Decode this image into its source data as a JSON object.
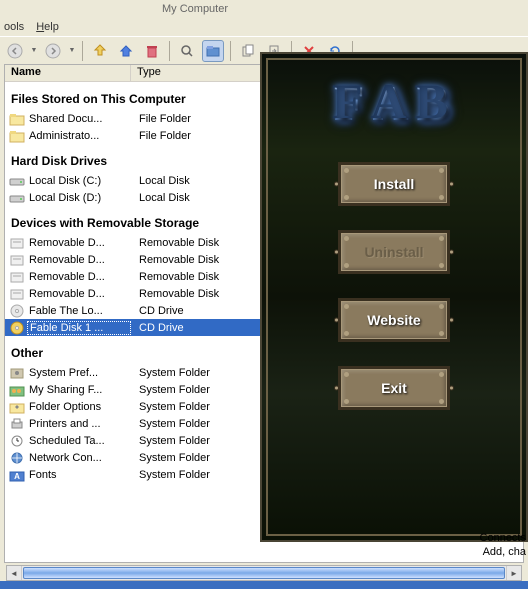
{
  "window": {
    "title": "My Computer"
  },
  "menu": {
    "tools": "ools",
    "help": "Help"
  },
  "columns": {
    "name": "Name",
    "type": "Type"
  },
  "groups": {
    "files_stored": "Files Stored on This Computer",
    "hard_drives": "Hard Disk Drives",
    "removable": "Devices with Removable Storage",
    "other": "Other"
  },
  "items": {
    "shared_docs": {
      "name": "Shared Docu...",
      "type": "File Folder"
    },
    "admin": {
      "name": "Administrato...",
      "type": "File Folder"
    },
    "disk_c": {
      "name": "Local Disk (C:)",
      "type": "Local Disk"
    },
    "disk_d": {
      "name": "Local Disk (D:)",
      "type": "Local Disk"
    },
    "rem1": {
      "name": "Removable D...",
      "type": "Removable Disk"
    },
    "rem2": {
      "name": "Removable D...",
      "type": "Removable Disk"
    },
    "rem3": {
      "name": "Removable D...",
      "type": "Removable Disk"
    },
    "rem4": {
      "name": "Removable D...",
      "type": "Removable Disk"
    },
    "fable_lo": {
      "name": "Fable The Lo...",
      "type": "CD Drive"
    },
    "fable_disk1": {
      "name": "Fable Disk 1 ...",
      "type": "CD Drive"
    },
    "sys_pref": {
      "name": "System Pref...",
      "type": "System Folder"
    },
    "sharing": {
      "name": "My Sharing F...",
      "type": "System Folder"
    },
    "folder_opt": {
      "name": "Folder Options",
      "type": "System Folder"
    },
    "printers": {
      "name": "Printers and ...",
      "type": "System Folder"
    },
    "sched": {
      "name": "Scheduled Ta...",
      "type": "System Folder"
    },
    "network": {
      "name": "Network Con...",
      "type": "System Folder"
    },
    "fonts": {
      "name": "Fonts",
      "type": "System Folder"
    }
  },
  "fable": {
    "title_letters": [
      "F",
      "A",
      "B"
    ],
    "install": "Install",
    "uninstall": "Uninstall",
    "website": "Website",
    "exit": "Exit",
    "status1": "Connects",
    "status2": "Add, cha"
  },
  "taskbar": {
    "item": ""
  }
}
